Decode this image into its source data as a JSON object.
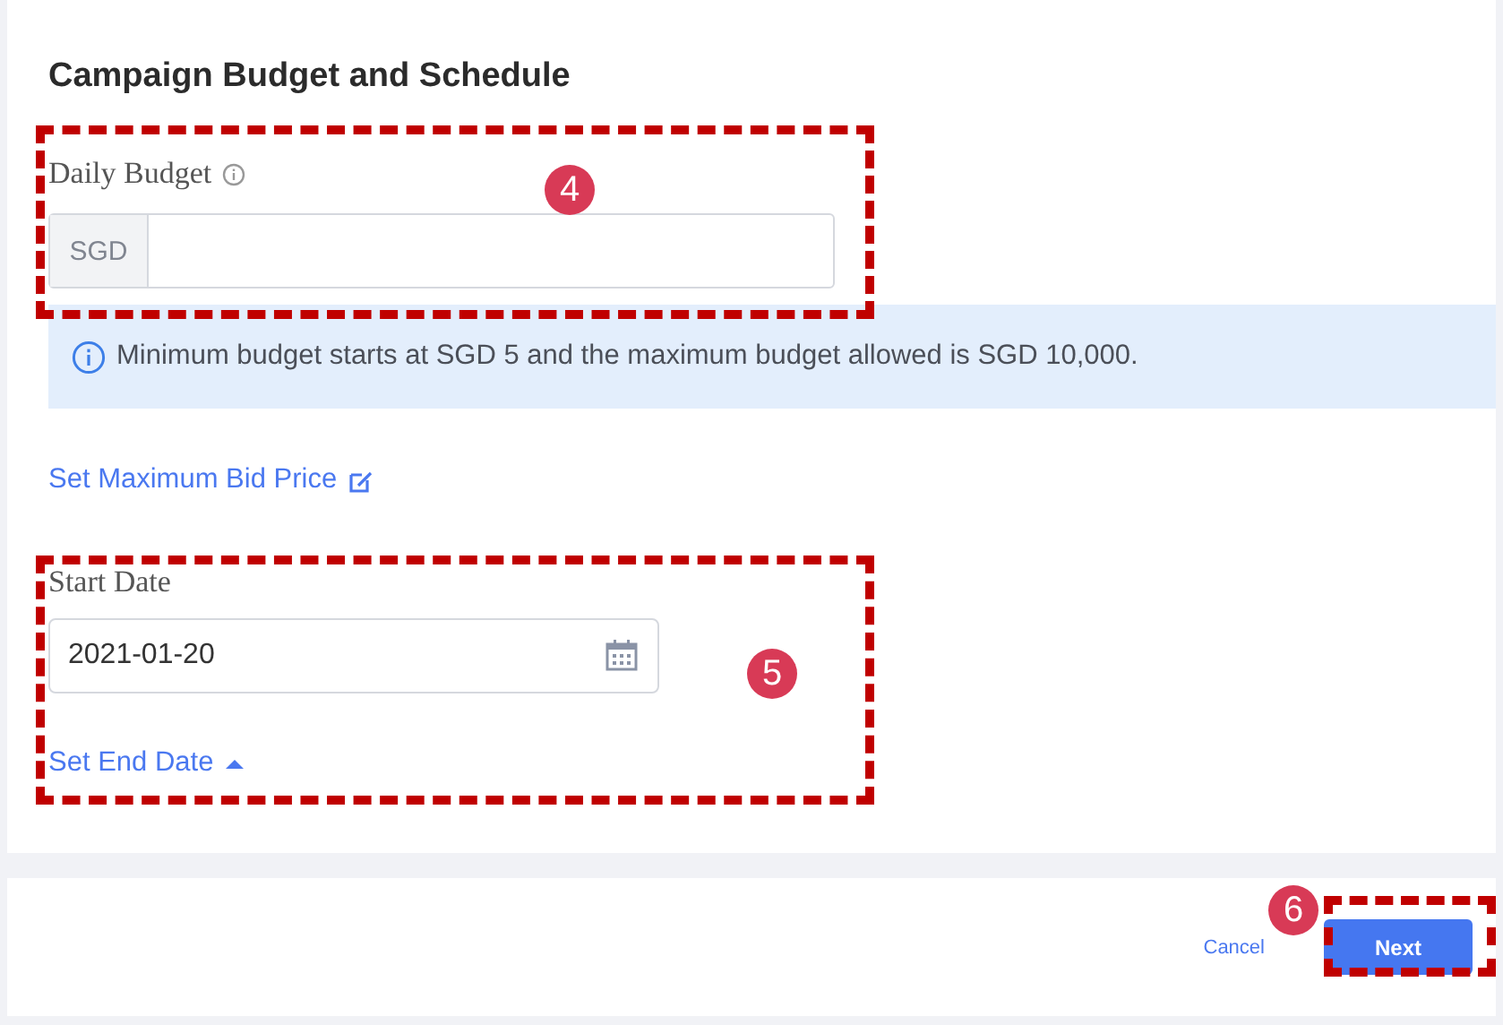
{
  "section": {
    "title": "Campaign Budget and Schedule"
  },
  "budget": {
    "label": "Daily Budget",
    "prefix": "SGD",
    "annotation": "4"
  },
  "notice": {
    "text": "Minimum budget starts at SGD 5 and the maximum budget allowed is SGD 10,000."
  },
  "bid_link": {
    "label": "Set Maximum Bid Price"
  },
  "schedule": {
    "label": "Start Date",
    "value": "2021-01-20",
    "end_link": "Set End Date",
    "expanded": true,
    "annotation": "5"
  },
  "footer": {
    "cancel": "Cancel",
    "next": "Next",
    "annotation": "6"
  }
}
